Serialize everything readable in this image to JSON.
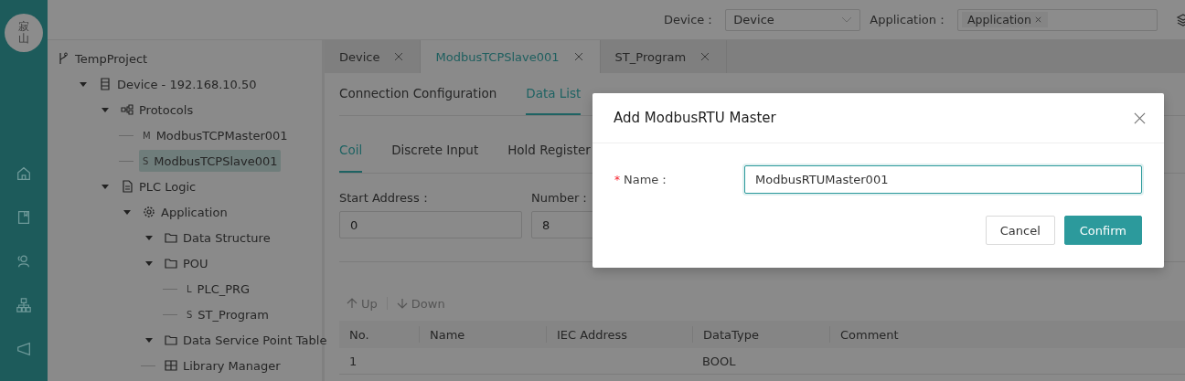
{
  "logo": "寂山",
  "rail": [
    {
      "kind": "home"
    },
    {
      "kind": "book"
    },
    {
      "kind": "people"
    },
    {
      "kind": "sitemap"
    },
    {
      "kind": "megaphone"
    }
  ],
  "header": {
    "device_label": "Device：",
    "device_value": "Device",
    "application_label": "Application：",
    "application_tags": [
      "Application"
    ]
  },
  "tree": [
    {
      "label": "TempProject",
      "kind": "branch",
      "selected": false,
      "children": [
        {
          "label": "Device - 192.168.10.50",
          "kind": "server",
          "expanded": true,
          "selected": false,
          "children": [
            {
              "label": "Protocols",
              "kind": "network",
              "expanded": true,
              "selected": false,
              "children": [
                {
                  "label": "ModbusTCPMaster001",
                  "badge": "M",
                  "selected": false
                },
                {
                  "label": "ModbusTCPSlave001",
                  "badge": "S",
                  "selected": true
                }
              ]
            },
            {
              "label": "PLC Logic",
              "kind": "doc",
              "expanded": true,
              "selected": false,
              "children": [
                {
                  "label": "Application",
                  "kind": "gear",
                  "expanded": true,
                  "selected": false,
                  "children": [
                    {
                      "label": "Data Structure",
                      "kind": "folder",
                      "expanded": true,
                      "selected": false
                    },
                    {
                      "label": "POU",
                      "kind": "folder",
                      "expanded": true,
                      "selected": false,
                      "children": [
                        {
                          "label": "PLC_PRG",
                          "badge": "L",
                          "selected": false
                        },
                        {
                          "label": "ST_Program",
                          "badge": "S",
                          "selected": false
                        }
                      ]
                    },
                    {
                      "label": "Data Service Point Table",
                      "kind": "folder",
                      "expanded": true,
                      "selected": false
                    },
                    {
                      "label": "Library Manager",
                      "kind": "grid",
                      "selected": false
                    }
                  ]
                }
              ]
            }
          ]
        }
      ]
    }
  ],
  "tabs": [
    {
      "label": "Device",
      "selected": false
    },
    {
      "label": "ModbusTCPSlave001",
      "selected": true
    },
    {
      "label": "ST_Program",
      "selected": false
    }
  ],
  "subtabs": [
    {
      "label": "Connection Configuration",
      "selected": false
    },
    {
      "label": "Data List",
      "selected": true
    }
  ],
  "register_tabs": [
    {
      "label": "Coil",
      "selected": true
    },
    {
      "label": "Discrete Input",
      "selected": false
    },
    {
      "label": "Hold Register",
      "selected": false
    }
  ],
  "fields": [
    {
      "label": "Start Address：",
      "value": "0"
    },
    {
      "label": "Number：",
      "value": "8"
    }
  ],
  "toolbar": [
    {
      "label": "Up",
      "kind": "up",
      "disabled": true
    },
    {
      "label": "Down",
      "kind": "down",
      "disabled": true
    }
  ],
  "table": {
    "columns": [
      "No.",
      "Name",
      "IEC Address",
      "DataType",
      "Comment"
    ],
    "rows": [
      [
        "1",
        "",
        "",
        "BOOL",
        ""
      ]
    ]
  },
  "dialog": {
    "title": "Add ModbusRTU Master",
    "field": {
      "required_mark": "*",
      "label": "Name：",
      "value": "ModbusRTUMaster001"
    },
    "buttons": [
      {
        "label": "Cancel",
        "kind": "default"
      },
      {
        "label": "Confirm",
        "kind": "primary"
      }
    ]
  }
}
